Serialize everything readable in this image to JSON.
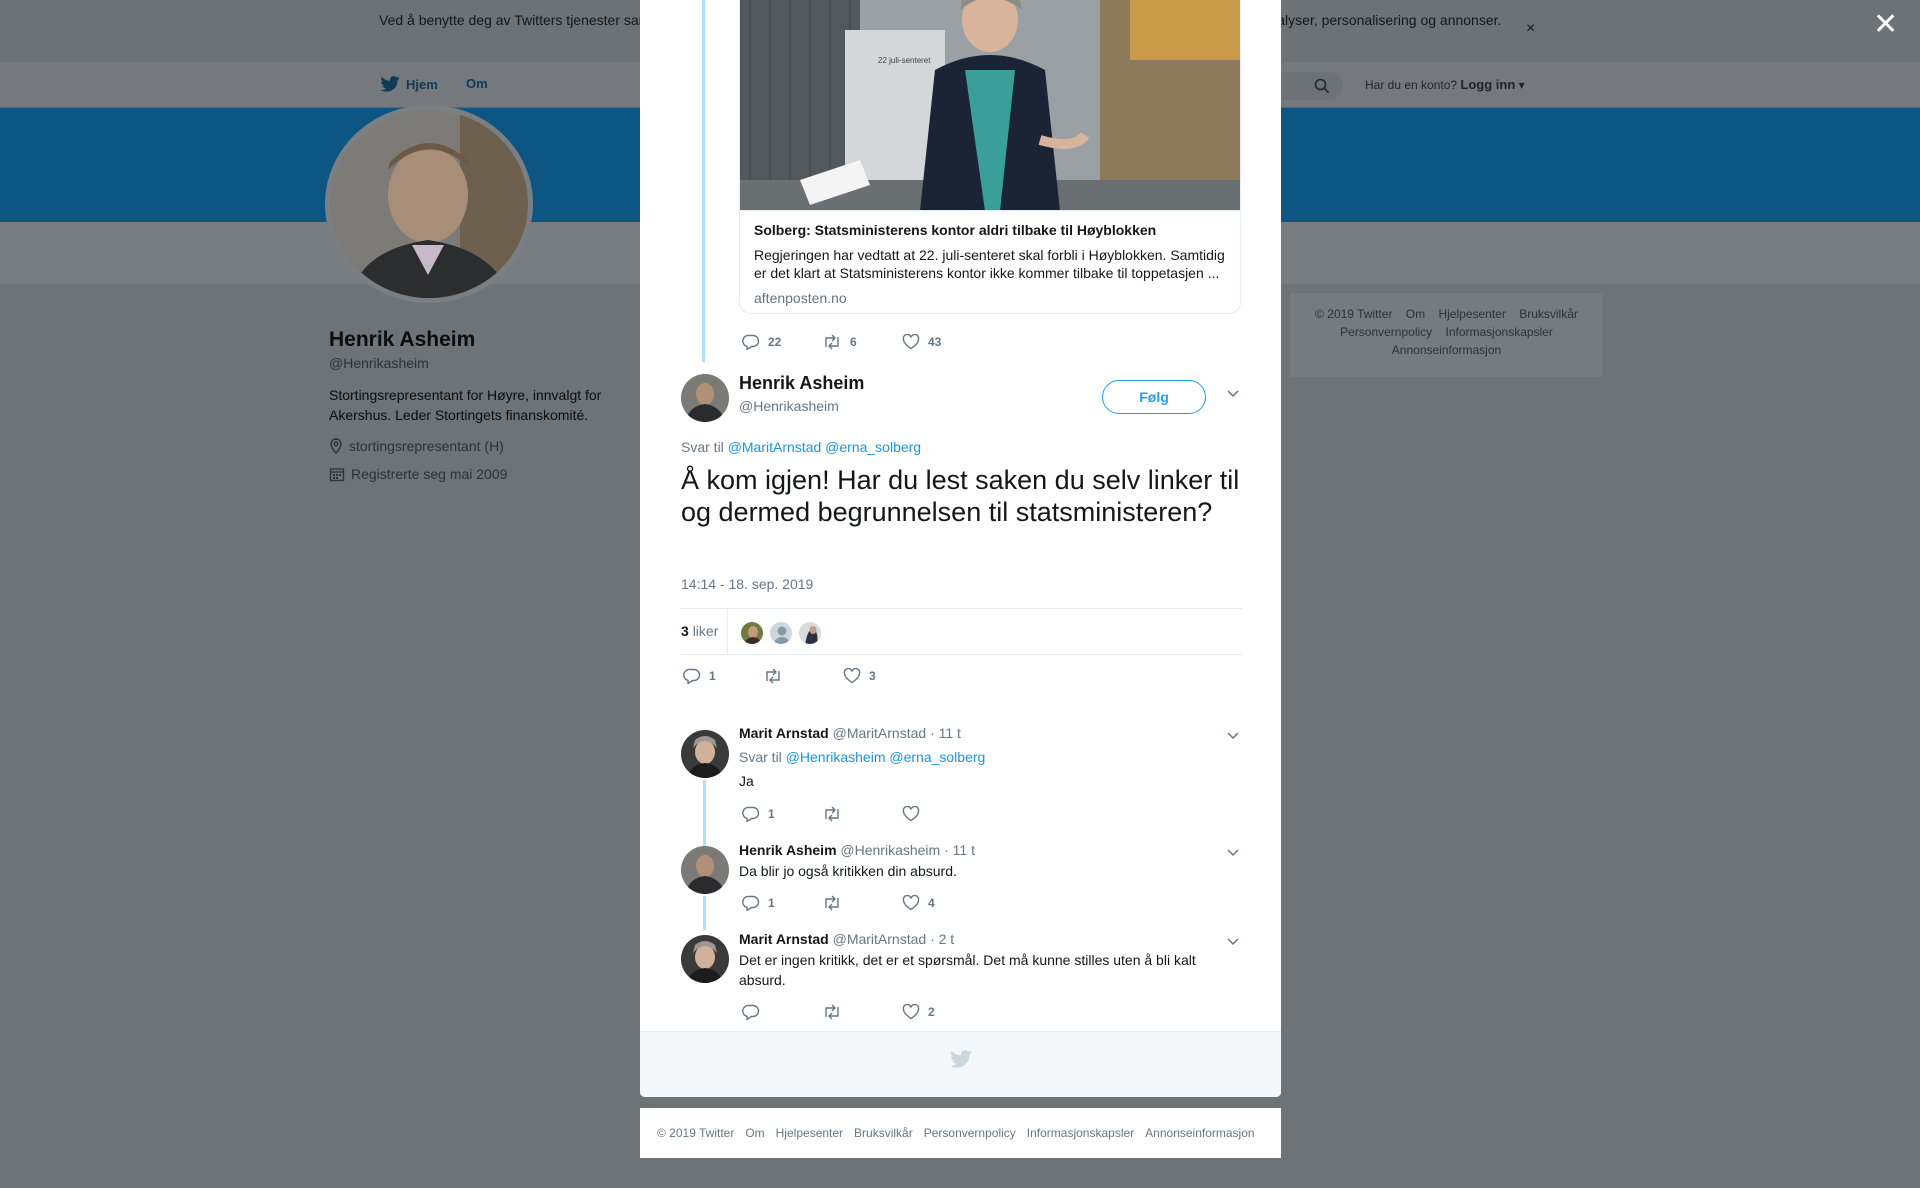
{
  "background": {
    "cookie_text": "Ved å benytte deg av Twitters tjenester samtykker du i vår bruk av informasjonskapsler. Vi og våre partnere bruker informasjonskapsler til bl.a. analyser, personalisering og annonser.",
    "nav": {
      "home": "Hjem",
      "about": "Om",
      "login_prompt": "Har du en konto?",
      "login": "Logg inn"
    },
    "profile": {
      "name": "Henrik Asheim",
      "handle": "@Henrikasheim",
      "bio": "Stortingsrepresentant for Høyre, innvalgt for Akershus. Leder Stortingets finanskomité.",
      "location": "stortingsrepresentant (H)",
      "joined": "Registrerte seg mai 2009"
    },
    "side_footer": [
      "© 2019 Twitter",
      "Om",
      "Hjelpesenter",
      "Bruksvilkår",
      "Personvernpolicy",
      "Informasjonskapsler",
      "Annonseinformasjon"
    ]
  },
  "card": {
    "title": "Solberg: Statsministerens kontor aldri tilbake til Høyblokken",
    "description": "Regjeringen har vedtatt at 22. juli-senteret skal forbli i Høyblokken. Samtidig er det klart at Statsministerens kontor ikke kommer tilbake til toppetasjen ...",
    "domain": "aftenposten.no",
    "image_sign": "22 juli-senteret",
    "replies": "22",
    "retweets": "6",
    "likes": "43"
  },
  "main_tweet": {
    "name": "Henrik Asheim",
    "handle": "@Henrikasheim",
    "follow_label": "Følg",
    "reply_prefix": "Svar til",
    "reply_mentions": "@MaritArnstad @erna_solberg",
    "text": "Å kom igjen! Har du lest saken du selv linker til og dermed begrunnelsen til statsministeren?",
    "timestamp": "14:14 - 18. sep. 2019",
    "likes_count": "3",
    "likes_label": "liker",
    "replies": "1",
    "retweets": "",
    "likes": "3"
  },
  "replies": [
    {
      "name": "Marit Arnstad",
      "handle": "@MaritArnstad",
      "time": "· 11 t",
      "reply_prefix": "Svar til",
      "reply_mentions": "@Henrikasheim @erna_solberg",
      "text": "Ja",
      "replies": "1",
      "retweets": "",
      "likes": ""
    },
    {
      "name": "Henrik Asheim",
      "handle": "@Henrikasheim",
      "time": "· 11 t",
      "text": "Da blir jo også kritikken din absurd.",
      "replies": "1",
      "retweets": "",
      "likes": "4"
    },
    {
      "name": "Marit Arnstad",
      "handle": "@MaritArnstad",
      "time": "· 2 t",
      "text": "Det er ingen kritikk, det er et spørsmål. Det må kunne stilles uten å bli kalt absurd.",
      "replies": "",
      "retweets": "",
      "likes": "2"
    }
  ],
  "footer": [
    "© 2019 Twitter",
    "Om",
    "Hjelpesenter",
    "Bruksvilkår",
    "Personvernpolicy",
    "Informasjonskapsler",
    "Annonseinformasjon"
  ],
  "colors": {
    "accent": "#1da1f2",
    "link": "#1b95e0",
    "muted": "#657786",
    "thread": "#b3dff7"
  },
  "icons": [
    "close-icon",
    "twitter-bird-icon",
    "search-icon",
    "location-icon",
    "calendar-icon",
    "reply-icon",
    "retweet-icon",
    "like-icon",
    "chevron-down-icon"
  ]
}
